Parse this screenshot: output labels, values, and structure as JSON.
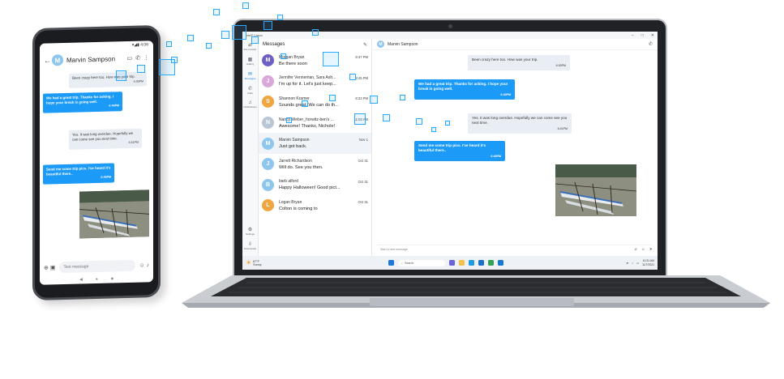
{
  "phone": {
    "status_time": "4:06",
    "contact_name": "Marvin Sampson",
    "avatar_initial": "M",
    "messages": [
      {
        "dir": "in",
        "text": "Been crazy here too. How was your trip.",
        "time": "6:30PM"
      },
      {
        "dir": "out",
        "text": "We had a great trip. Thanks for asking. I hope your break is going well.",
        "time": "6:40PM"
      },
      {
        "dir": "in",
        "text": "Yes. It was long overdue. Hopefully we can come see you next time.",
        "time": "6:41PM"
      },
      {
        "dir": "out",
        "text": "Send me some trip pics. I've heard it's beautiful there..",
        "time": "6:45PM"
      }
    ],
    "input_placeholder": "Text message"
  },
  "laptop": {
    "window_title": "Intel® Unison",
    "list_title": "Messages",
    "rail": [
      {
        "icon": "file-icon",
        "label": "File transfer"
      },
      {
        "icon": "photo-icon",
        "label": "Gallery"
      },
      {
        "icon": "message-icon",
        "label": "Messages"
      },
      {
        "icon": "phone-icon",
        "label": "Calls"
      },
      {
        "icon": "bell-icon",
        "label": "Notifications"
      }
    ],
    "rail_bottom": [
      {
        "icon": "gear-icon",
        "label": "Settings"
      },
      {
        "icon": "download-icon",
        "label": "Downloads"
      }
    ],
    "conversations": [
      {
        "initial": "M",
        "name": "Morgan Bryan",
        "msg": "Be there soon",
        "time": "8:47 PM",
        "color": "#6d5fc4"
      },
      {
        "initial": "J",
        "name": "Jennifer Venneman, Sara Ash...",
        "msg": "I'm up for it. Let's just keep...",
        "time": "8:45 PM",
        "color": "#d9a7d9"
      },
      {
        "initial": "S",
        "name": "Shannon Kramer",
        "msg": "Sounds great. We can do th...",
        "time": "8:23 PM",
        "color": "#f0a640"
      },
      {
        "initial": "N",
        "name": "Nancy Weber_horwitz-ben's ...",
        "msg": "Awesome! Thanks, Nichole!",
        "time": "11:02 AM",
        "color": "#b8c6d6"
      },
      {
        "initial": "M",
        "name": "Marvin Sampson",
        "msg": "Just got back.",
        "time": "Nov 1",
        "color": "#8fc6ee"
      },
      {
        "initial": "J",
        "name": "Jarrett Richardson",
        "msg": "Will do. See you then.",
        "time": "Oct 31",
        "color": "#8fc6ee"
      },
      {
        "initial": "B",
        "name": "barb alford",
        "msg": "Happy Halloween! Good pict...",
        "time": "Oct 31",
        "color": "#8fc6ee"
      },
      {
        "initial": "L",
        "name": "Logan Bryan",
        "msg": "Colton is coming to",
        "time": "Oct 31",
        "color": "#f0a640"
      }
    ],
    "thread_name": "Marvin Sampson",
    "messages": [
      {
        "dir": "in",
        "text": "Been crazy here too. How was your trip.",
        "time": "6:30PM"
      },
      {
        "dir": "out",
        "text": "We had a great trip. Thanks for asking. I hope your break is going well.",
        "time": "6:40PM"
      },
      {
        "dir": "in",
        "text": "Yes. It was long overdue. Hopefully we can come see you next time.",
        "time": "6:41PM"
      },
      {
        "dir": "out",
        "text": "Send me some trip pics. I've heard it's beautiful there..",
        "time": "6:45PM"
      }
    ],
    "compose_placeholder": "Start a new message",
    "taskbar": {
      "weather_temp": "67°F",
      "weather_desc": "Sunny",
      "search_label": "Search",
      "time": "10:31 AM",
      "date": "11/7/2021"
    }
  },
  "colors": {
    "accent": "#1b9af7",
    "incoming": "#e9eef5"
  }
}
